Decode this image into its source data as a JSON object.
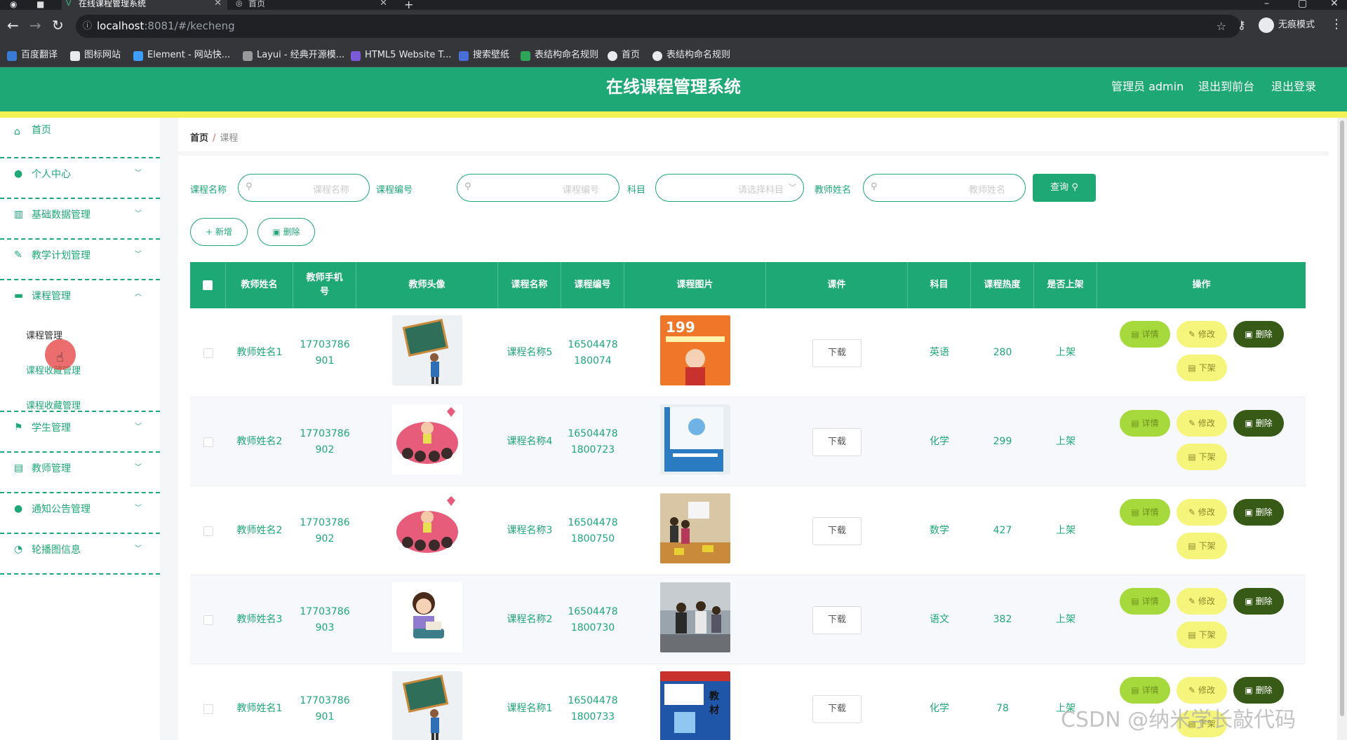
{
  "browser": {
    "tabs": [
      {
        "label": "在线课程管理系统",
        "active": true
      },
      {
        "label": "首页",
        "active": false
      }
    ],
    "url_host": "localhost",
    "url_rest": ":8081/#/kecheng",
    "incognito_label": "无痕模式",
    "bookmarks": [
      "百度翻译",
      "图标网站",
      "Element - 网站快...",
      "Layui - 经典开源模...",
      "HTML5 Website T...",
      "搜索壁纸",
      "表结构命名规则",
      "首页",
      "表结构命名规则"
    ]
  },
  "header": {
    "title": "在线课程管理系统",
    "admin_label": "管理员 admin",
    "frontend_link": "退出到前台",
    "logout_link": "退出登录"
  },
  "sidebar": {
    "items": [
      {
        "label": "首页",
        "icon": "home-icon"
      },
      {
        "label": "个人中心",
        "icon": "user-icon"
      },
      {
        "label": "基础数据管理",
        "icon": "chart-icon"
      },
      {
        "label": "教学计划管理",
        "icon": "pen-icon"
      },
      {
        "label": "课程管理",
        "icon": "briefcase-icon",
        "expanded": true,
        "children": [
          "课程管理",
          "课程收藏管理",
          "课程收藏管理"
        ]
      },
      {
        "label": "学生管理",
        "icon": "flag-icon"
      },
      {
        "label": "教师管理",
        "icon": "clipboard-icon"
      },
      {
        "label": "通知公告管理",
        "icon": "person-icon"
      },
      {
        "label": "轮播图信息",
        "icon": "gauge-icon"
      }
    ]
  },
  "breadcrumb": {
    "home": "首页",
    "separator": "/",
    "current": "课程"
  },
  "filters": {
    "course_name_label": "课程名称",
    "course_name_placeholder": "课程名称",
    "course_code_label": "课程编号",
    "course_code_placeholder": "课程编号",
    "subject_label": "科目",
    "subject_placeholder": "请选择科目",
    "teacher_label": "教师姓名",
    "teacher_placeholder": "教师姓名",
    "query_button": "查询"
  },
  "actions": {
    "add": "新增",
    "delete": "删除"
  },
  "table": {
    "columns": [
      "教师姓名",
      "教师手机号",
      "教师头像",
      "课程名称",
      "课程编号",
      "课程图片",
      "课件",
      "科目",
      "课程热度",
      "是否上架",
      "操作"
    ],
    "rows": [
      {
        "teacher": "教师姓名1",
        "phone1": "17703786",
        "phone2": "901",
        "course": "课程名称5",
        "code1": "16504478",
        "code2": "180074",
        "courseware": "下载",
        "subject": "英语",
        "heat": "280",
        "status": "上架",
        "avatar": "blackboard",
        "cover": "orange-book"
      },
      {
        "teacher": "教师姓名2",
        "phone1": "17703786",
        "phone2": "902",
        "course": "课程名称4",
        "code1": "16504478",
        "code2": "1800723",
        "courseware": "下载",
        "subject": "化学",
        "heat": "299",
        "status": "上架",
        "avatar": "classroom",
        "cover": "blue-book"
      },
      {
        "teacher": "教师姓名2",
        "phone1": "17703786",
        "phone2": "902",
        "course": "课程名称3",
        "code1": "16504478",
        "code2": "1800750",
        "courseware": "下载",
        "subject": "数学",
        "heat": "427",
        "status": "上架",
        "avatar": "classroom",
        "cover": "class-photo"
      },
      {
        "teacher": "教师姓名3",
        "phone1": "17703786",
        "phone2": "903",
        "course": "课程名称2",
        "code1": "16504478",
        "code2": "1800730",
        "courseware": "下载",
        "subject": "语文",
        "heat": "382",
        "status": "上架",
        "avatar": "reader",
        "cover": "students-photo"
      },
      {
        "teacher": "教师姓名1",
        "phone1": "17703786",
        "phone2": "901",
        "course": "课程名称1",
        "code1": "16504478",
        "code2": "1800733",
        "courseware": "下载",
        "subject": "化学",
        "heat": "78",
        "status": "上架",
        "avatar": "blackboard",
        "cover": "chem-book"
      }
    ],
    "row_actions": {
      "detail": "详情",
      "edit": "修改",
      "delete": "删除",
      "offline": "下架"
    }
  },
  "watermark": "CSDN @纳米学长敲代码",
  "colors": {
    "primary": "#1ea876",
    "accent_yellow": "#f2f254",
    "detail_btn": "#a6d93b",
    "delete_btn": "#375b16"
  }
}
